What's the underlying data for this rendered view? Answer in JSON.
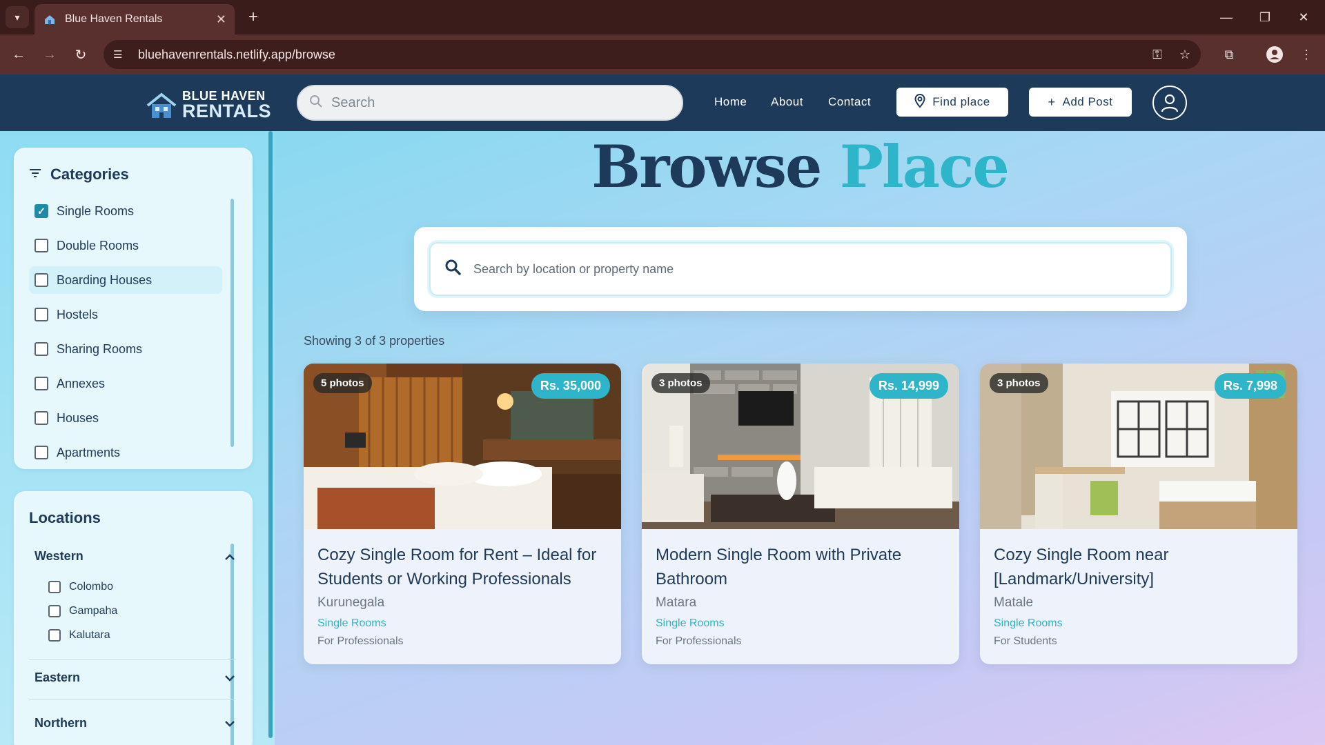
{
  "browser": {
    "tab_title": "Blue Haven Rentals",
    "url": "bluehavenrentals.netlify.app/browse"
  },
  "header": {
    "logo_line1": "BLUE HAVEN",
    "logo_line2": "RENTALS",
    "search_placeholder": "Search",
    "nav": [
      "Home",
      "About",
      "Contact"
    ],
    "find_place_label": "Find place",
    "add_post_label": "Add Post"
  },
  "sidebar": {
    "categories_title": "Categories",
    "categories": [
      {
        "label": "Single Rooms",
        "checked": true
      },
      {
        "label": "Double Rooms",
        "checked": false
      },
      {
        "label": "Boarding Houses",
        "checked": false
      },
      {
        "label": "Hostels",
        "checked": false
      },
      {
        "label": "Sharing Rooms",
        "checked": false
      },
      {
        "label": "Annexes",
        "checked": false
      },
      {
        "label": "Houses",
        "checked": false
      },
      {
        "label": "Apartments",
        "checked": false
      }
    ],
    "locations_title": "Locations",
    "regions": [
      {
        "name": "Western",
        "expanded": true,
        "districts": [
          "Colombo",
          "Gampaha",
          "Kalutara"
        ]
      },
      {
        "name": "Eastern",
        "expanded": false
      },
      {
        "name": "Northern",
        "expanded": false
      }
    ]
  },
  "main": {
    "title_part1": "Browse",
    "title_part2": "Place",
    "search_placeholder": "Search by location or property name",
    "showing_text": "Showing 3 of 3 properties",
    "accent_color": "#2fb5c9",
    "brand_color": "#1e3a5a",
    "listings": [
      {
        "photos": "5 photos",
        "price": "Rs. 35,000",
        "title": "Cozy Single Room for Rent – Ideal for Students or Working Professionals",
        "location": "Kurunegala",
        "category": "Single Rooms",
        "audience": "For Professionals"
      },
      {
        "photos": "3 photos",
        "price": "Rs. 14,999",
        "title": "Modern Single Room with Private Bathroom",
        "location": "Matara",
        "category": "Single Rooms",
        "audience": "For Professionals"
      },
      {
        "photos": "3 photos",
        "price": "Rs. 7,998",
        "title": "Cozy Single Room near [Landmark/University]",
        "location": "Matale",
        "category": "Single Rooms",
        "audience": "For Students"
      }
    ]
  }
}
